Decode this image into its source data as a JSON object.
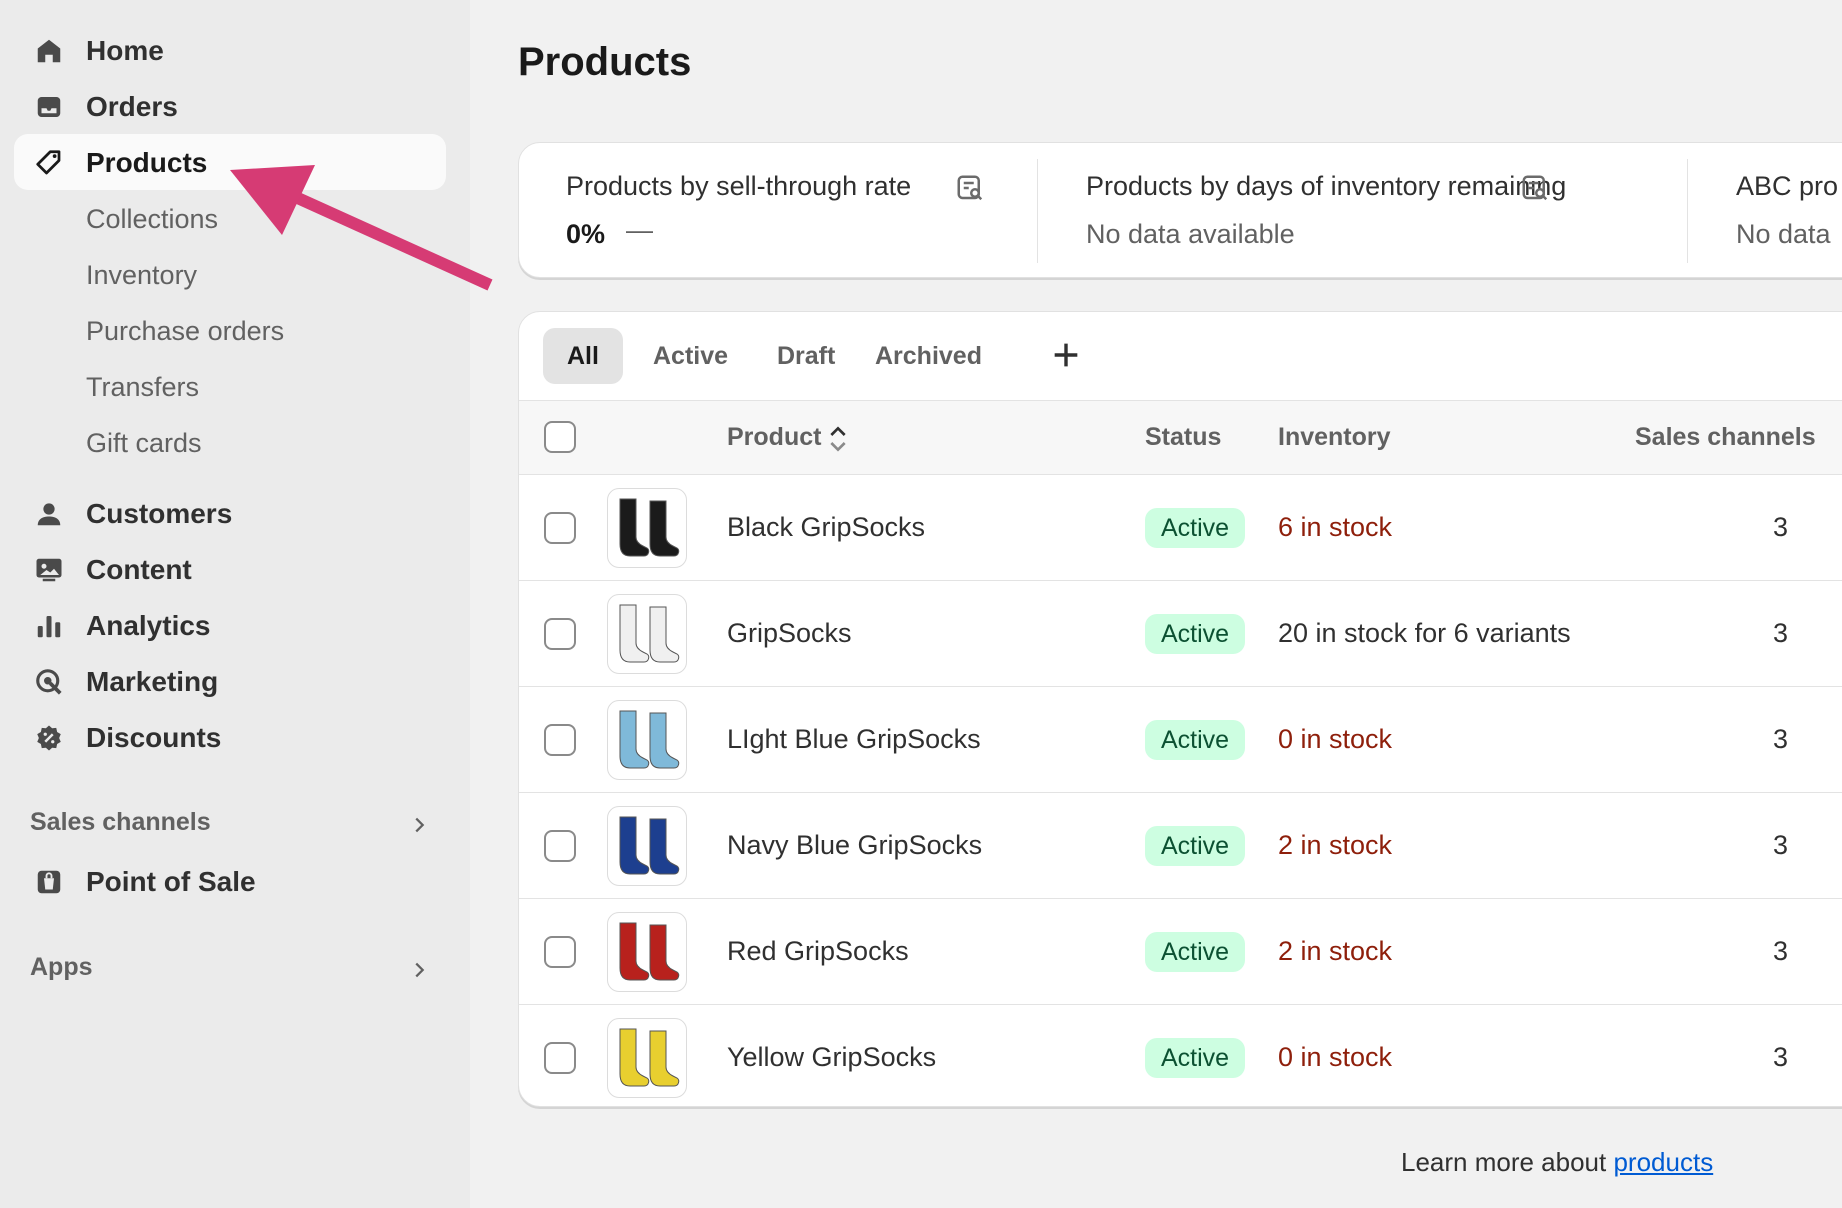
{
  "sidebar": {
    "nav": [
      {
        "label": "Home",
        "icon": "home-icon"
      },
      {
        "label": "Orders",
        "icon": "inbox-icon"
      },
      {
        "label": "Products",
        "icon": "tag-icon",
        "selected": true
      },
      {
        "label": "Customers",
        "icon": "person-icon"
      },
      {
        "label": "Content",
        "icon": "image-icon"
      },
      {
        "label": "Analytics",
        "icon": "bar-chart-icon"
      },
      {
        "label": "Marketing",
        "icon": "target-icon"
      },
      {
        "label": "Discounts",
        "icon": "discount-icon"
      }
    ],
    "sub_items": [
      "Collections",
      "Inventory",
      "Purchase orders",
      "Transfers",
      "Gift cards"
    ],
    "sales_channels_label": "Sales channels",
    "pos_label": "Point of Sale",
    "apps_label": "Apps"
  },
  "main": {
    "title": "Products",
    "metrics": [
      {
        "title": "Products by sell-through rate",
        "value": "0%",
        "value_suffix": "—"
      },
      {
        "title": "Products by days of inventory remaining",
        "value": "No data available"
      },
      {
        "title": "ABC pro",
        "value": "No data"
      }
    ],
    "tabs": [
      "All",
      "Active",
      "Draft",
      "Archived"
    ],
    "columns": {
      "product": "Product",
      "status": "Status",
      "inventory": "Inventory",
      "sales_channels": "Sales channels"
    },
    "rows": [
      {
        "name": "Black GripSocks",
        "status": "Active",
        "inventory": "6 in stock",
        "inv_low": true,
        "channels": "3",
        "color": "#1b1b1b"
      },
      {
        "name": "GripSocks",
        "status": "Active",
        "inventory": "20 in stock for 6 variants",
        "inv_low": false,
        "channels": "3",
        "color": "#f0f0f0"
      },
      {
        "name": "LIght Blue GripSocks",
        "status": "Active",
        "inventory": "0 in stock",
        "inv_low": true,
        "channels": "3",
        "color": "#7fb9d9"
      },
      {
        "name": "Navy Blue GripSocks",
        "status": "Active",
        "inventory": "2 in stock",
        "inv_low": true,
        "channels": "3",
        "color": "#1d3f8f"
      },
      {
        "name": "Red GripSocks",
        "status": "Active",
        "inventory": "2 in stock",
        "inv_low": true,
        "channels": "3",
        "color": "#b8211d"
      },
      {
        "name": "Yellow GripSocks",
        "status": "Active",
        "inventory": "0 in stock",
        "inv_low": true,
        "channels": "3",
        "color": "#e8cf2f"
      }
    ],
    "footer": {
      "prefix": "Learn more about ",
      "link": "products"
    }
  },
  "colors": {
    "accent_link": "#005bd3",
    "badge_bg": "#cdfee1",
    "low_stock": "#8e1f0b",
    "annotation_arrow": "#d63b74"
  }
}
